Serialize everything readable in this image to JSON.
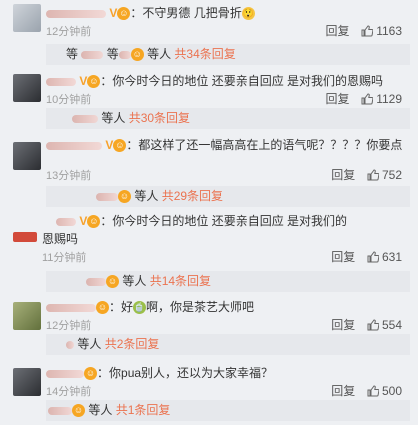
{
  "comments": [
    {
      "text": "不守男德 几把骨折",
      "time": "12分钟前",
      "reply_label": "回复",
      "likes": "1163",
      "reply_prefix": "等",
      "reply_prefix2": "等人",
      "reply_count": "共34条回复"
    },
    {
      "text": "你今时今日的地位 还要亲自回应 是对我们的恩赐吗",
      "time": "10分钟前",
      "reply_label": "回复",
      "likes": "1129",
      "reply_prefix": "等人",
      "reply_count": "共30条回复"
    },
    {
      "text": "都这样了还一幅高高在上的语气呢？？？？你要点",
      "time": "13分钟前",
      "reply_label": "回复",
      "likes": "752",
      "reply_prefix": "等人",
      "reply_count": "共29条回复"
    },
    {
      "text": "你今时今日的地位 还要亲自回应 是对我们的",
      "text2": "恩赐吗",
      "time": "11分钟前",
      "reply_label": "回复",
      "likes": "631",
      "reply_prefix": "等人",
      "reply_count": "共14条回复"
    },
    {
      "text_a": "好",
      "text_b": "啊，你是茶艺大师吧",
      "time": "12分钟前",
      "reply_label": "回复",
      "likes": "554",
      "reply_prefix": "等人",
      "reply_count": "共2条回复"
    },
    {
      "text": "你pua别人，还以为大家幸福？",
      "time": "14分钟前",
      "reply_label": "回复",
      "likes": "500",
      "reply_prefix": "等人",
      "reply_count": "共1条回复"
    }
  ],
  "colors": {
    "link": "#eb7350",
    "background": "#eef0f3",
    "reply_bar": "#e6e8ec"
  },
  "icons": [
    "vip-badge-icon",
    "like-thumb-icon",
    "emoji-icon"
  ]
}
